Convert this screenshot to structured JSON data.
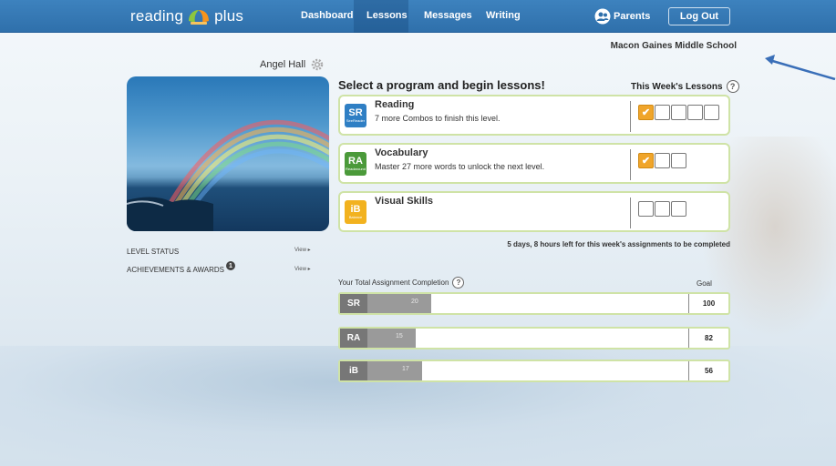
{
  "colors": {
    "topbar": "#3478b5",
    "accent_green": "#cfe3a6",
    "checked_box": "#f0a52a",
    "arrow": "#3a6fb8"
  },
  "header": {
    "logo_text_left": "reading",
    "logo_text_right": "plus",
    "nav": [
      "Dashboard",
      "Lessons",
      "Messages",
      "Writing"
    ],
    "active_nav": "Lessons",
    "parents_label": "Parents",
    "logout_label": "Log Out"
  },
  "school_name": "Macon Gaines Middle School",
  "user": {
    "name": "Angel Hall",
    "settings_icon": "gear-icon"
  },
  "left_links": [
    {
      "label": "LEVEL STATUS",
      "action": "View ▸"
    },
    {
      "label": "ACHIEVEMENTS & AWARDS",
      "badge": "1",
      "action": "View ▸"
    }
  ],
  "lessons": {
    "title": "Select a program and begin lessons!",
    "week_title": "This Week's Lessons",
    "programs": [
      {
        "icon_text": "SR",
        "icon_sub": "SeeReader",
        "icon_color": "#2f7fc4",
        "name": "Reading",
        "desc": "7 more Combos to finish this level.",
        "boxes_total": 5,
        "boxes_done": 1
      },
      {
        "icon_text": "RA",
        "icon_sub": "Readaround",
        "icon_color": "#4b9a3a",
        "name": "Vocabulary",
        "desc": "Master 27 more words to unlock the next level.",
        "boxes_total": 3,
        "boxes_done": 1
      },
      {
        "icon_text": "iB",
        "icon_sub": "Balance",
        "icon_color": "#f2b21f",
        "name": "Visual Skills",
        "desc": "",
        "boxes_total": 3,
        "boxes_done": 0
      }
    ],
    "deadline": "5 days, 8 hours left for this week's assignments to be completed"
  },
  "completion": {
    "title": "Your Total Assignment Completion",
    "goal_label": "Goal",
    "rows": [
      {
        "label": "SR",
        "value": 20,
        "goal": 100
      },
      {
        "label": "RA",
        "value": 15,
        "goal": 82
      },
      {
        "label": "iB",
        "value": 17,
        "goal": 56
      }
    ]
  }
}
